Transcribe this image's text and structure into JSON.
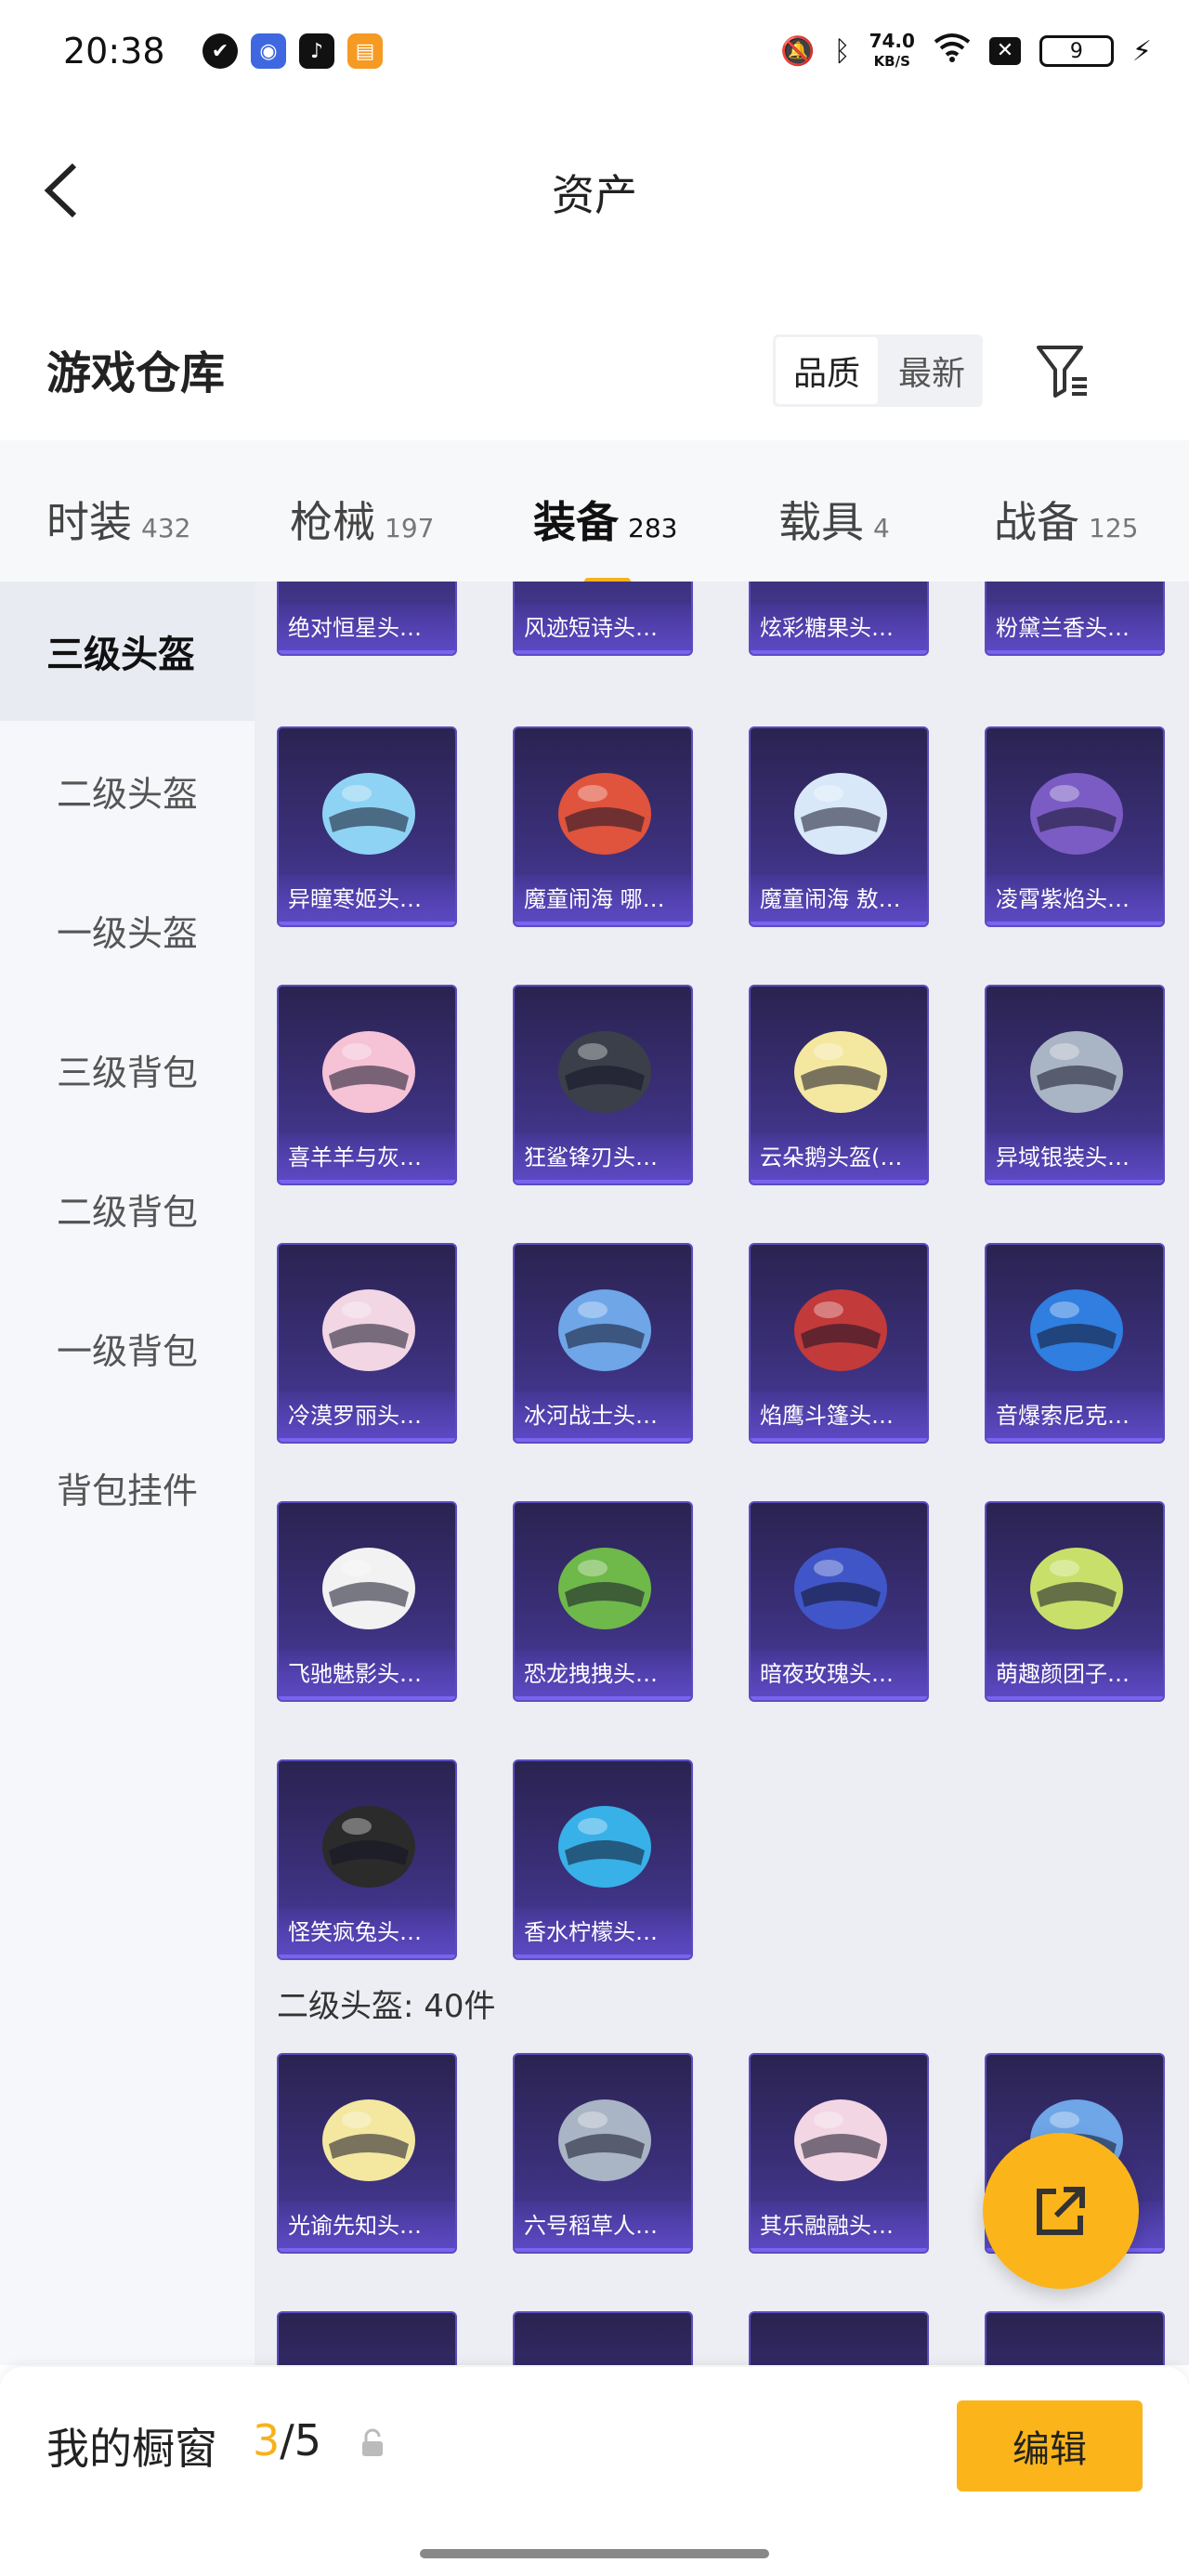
{
  "status_bar": {
    "time": "20:38",
    "net_speed": "74.0",
    "net_unit": "KB/S",
    "battery": "9"
  },
  "nav": {
    "title": "资产"
  },
  "header": {
    "title": "游戏仓库",
    "sort_options": [
      "品质",
      "最新"
    ],
    "sort_selected": "品质"
  },
  "tabs": [
    {
      "label": "时装",
      "count": "432"
    },
    {
      "label": "枪械",
      "count": "197"
    },
    {
      "label": "装备",
      "count": "283",
      "active": true
    },
    {
      "label": "载具",
      "count": "4"
    },
    {
      "label": "战备",
      "count": "125"
    }
  ],
  "sidebar": {
    "items": [
      "三级头盔",
      "二级头盔",
      "一级头盔",
      "三级背包",
      "二级背包",
      "一级背包",
      "背包挂件"
    ],
    "selected": "三级头盔"
  },
  "items_partial_top": [
    "绝对恒星头…",
    "风迹短诗头…",
    "炫彩糖果头…",
    "粉黛兰香头…"
  ],
  "items_lvl3": [
    "异瞳寒姬头…",
    "魔童闹海 哪…",
    "魔童闹海 敖…",
    "凌霄紫焰头…",
    "喜羊羊与灰…",
    "狂鲨锋刃头…",
    "云朵鹅头盔(…",
    "异域银装头…",
    "冷漠罗丽头…",
    "冰河战士头…",
    "焰鹰斗篷头…",
    "音爆索尼克…",
    "飞驰魅影头…",
    "恐龙拽拽头…",
    "暗夜玫瑰头…",
    "萌趣颜团子…",
    "怪笑疯兔头…",
    "香水柠檬头…"
  ],
  "section_lvl2": {
    "label": "二级头盔: 40件"
  },
  "items_lvl2": [
    "光谕先知头…",
    "六号稻草人…",
    "其乐融融头…",
    ""
  ],
  "showcase": {
    "title": "我的橱窗",
    "current": "3",
    "total": "/5",
    "edit_label": "编辑"
  },
  "colors": {
    "accent": "#fbb51a",
    "card_bg": "#3a2f78",
    "card_border": "#7a63f0"
  }
}
